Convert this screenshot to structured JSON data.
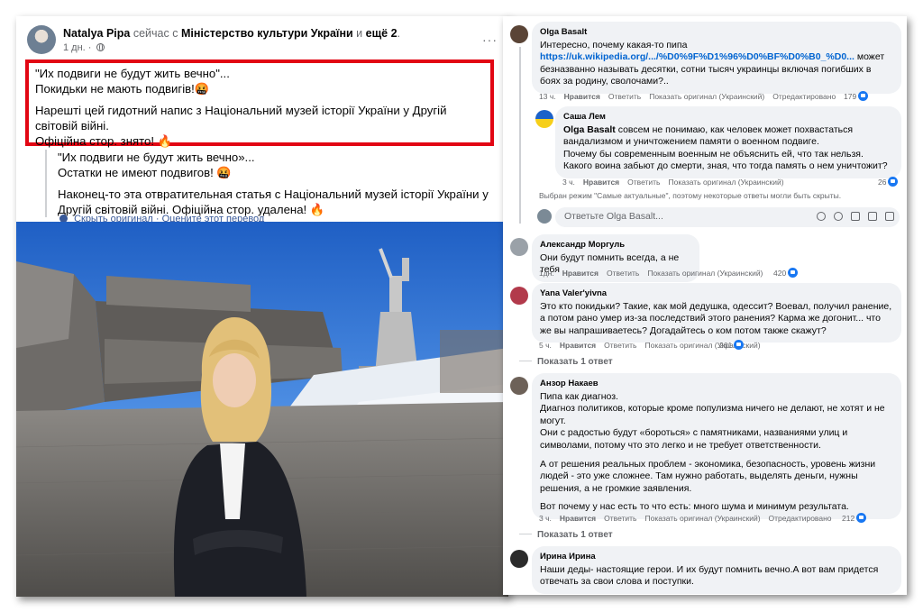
{
  "post": {
    "author": "Natalya Pipa",
    "connector": "сейчас с",
    "with_page": "Міністерство культури України",
    "and_word": "и",
    "others": "ещё 2",
    "time": "1 дн. ·",
    "more_icon": "more-dots-icon",
    "original": {
      "line1": "\"Их подвиги не будут жить вечно\"...",
      "line2": "Покидьки не мають подвигів!🤬",
      "line3": "Нарешті цей гидотний напис з Національний музей історії України у Другій світовій війні.",
      "line4": "Офіційна стор. знято! 🔥"
    },
    "translation": {
      "line1": "\"Их подвиги не будут жить вечно»...",
      "line2": "Остатки не имеют подвигов! 🤬",
      "line3": "Наконец-то эта отвратительная статья с Національний музей історії України у Другій світовій війні. Офіційна стор. удалена! 🔥"
    },
    "hide_original": "Скрыть оригинал",
    "separator": " · ",
    "rate_translation": "Оцените этот перевод"
  },
  "comments": {
    "c1": {
      "name": "Olga Basalt",
      "text_before": "Интересно, почему какая-то пипа",
      "link": "https://uk.wikipedia.org/.../%D0%9F%D1%96%D0%BF%D0%B0_%D0...",
      "text_after": "может безназванно называть десятки, сотни тысяч украинцы включая погибших в боях за родину, сволочами?..",
      "time": "13 ч.",
      "like": "Нравится",
      "reply": "Ответить",
      "show_original": "Показать оригинал (Украинский)",
      "edited": "Отредактировано",
      "likes": "179"
    },
    "r1": {
      "name": "Саша Лем",
      "mention": "Olga Basalt",
      "text": "совсем не понимаю, как человек может похвастаться вандализмом и уничтожением памяти о военном подвиге.",
      "text2": "Почему бы современным военным не объяснить ей, что так нельзя. Какого воина забьют до смерти, зная, что тогда память о нем уничтожит?",
      "time": "3 ч.",
      "like": "Нравится",
      "reply": "Ответить",
      "show_original": "Показать оригинал (Украинский)",
      "likes": "26"
    },
    "hint": "Выбран режим \"Самые актуальные\", поэтому некоторые ответы могли быть скрыты.",
    "reply_placeholder": "Ответьте Olga Basalt...",
    "c2": {
      "name": "Александр Моргуль",
      "text": "Они будут помнить всегда, а не тебя",
      "time": "1дн.",
      "like": "Нравится",
      "reply": "Ответить",
      "show_original": "Показать оригинал (Украинский)",
      "likes": "420"
    },
    "c3": {
      "name": "Yana Valer'yivna",
      "text": "Это кто покидьки? Такие, как мой дедушка, одессит? Воевал, получил ранение, а потом рано умер из-за последствий этого ранения? Карма же догонит... что же вы напрашиваетесь? Догадайтесь о ком потом также скажут?",
      "time": "5 ч.",
      "like": "Нравится",
      "reply": "Ответить",
      "show_original": "Показать оригинал (Украинский)",
      "likes": "261",
      "show_replies": "Показать 1 ответ"
    },
    "c4": {
      "name": "Анзор Накаев",
      "p1": "Пипа как диагноз.",
      "p2": "Диагноз политиков, которые кроме популизма ничего не делают, не хотят и не могут.",
      "p3": "Они с радостью будут «бороться» с памятниками, названиями улиц и символами, потому что это легко и не требует ответственности.",
      "p4": "А от решения реальных проблем - экономика, безопасность, уровень жизни людей - это уже сложнее. Там нужно работать, выделять деньги, нужны решения, а не громкие заявления.",
      "p5": "Вот почему у нас есть то что есть: много шума и минимум результата.",
      "time": "3 ч.",
      "like": "Нравится",
      "reply": "Ответить",
      "show_original": "Показать оригинал (Украинский)",
      "edited": "Отредактировано",
      "likes": "212",
      "show_replies": "Показать 1 ответ"
    },
    "c5": {
      "name": "Ирина Ирина",
      "text": "Наши деды- настоящие герои. И их будут помнить вечно.А вот вам придется отвечать за свои слова и поступки."
    }
  },
  "colors": {
    "highlight_border": "#e20613",
    "link": "#0064d1",
    "bubble": "#f0f2f5",
    "muted": "#65676b",
    "like_blue": "#1877f2"
  }
}
